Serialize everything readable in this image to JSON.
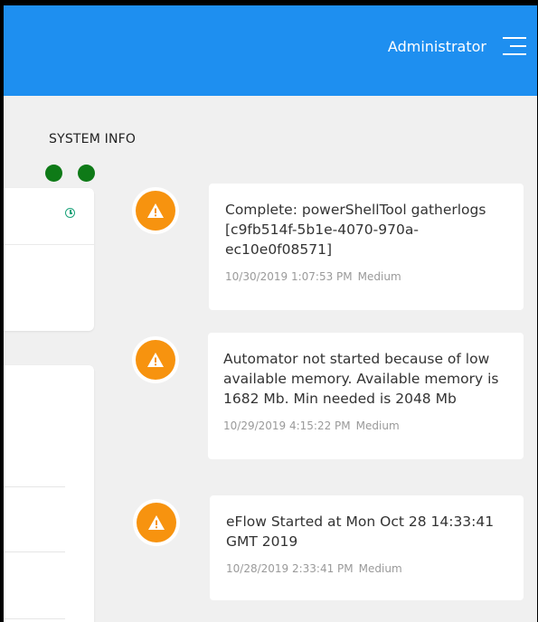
{
  "header": {
    "user": "Administrator",
    "menu_icon": "hamburger-menu-icon",
    "background_color": "#1e8ff0"
  },
  "section": {
    "title": "SYSTEM INFO",
    "indicator_color": "#0e7a17"
  },
  "icons": {
    "panel_clock": "clock-icon",
    "notification": "warning-icon",
    "notification_color": "#f7930f"
  },
  "notifications": [
    {
      "message": "Complete: powerShellTool gatherlogs [c9fb514f-5b1e-4070-970a-ec10e0f08571]",
      "timestamp": "10/30/2019 1:07:53 PM",
      "severity": "Medium"
    },
    {
      "message": "Automator not started because of low available memory. Available memory is 1682 Mb. Min needed is 2048 Mb",
      "timestamp": "10/29/2019 4:15:22 PM",
      "severity": "Medium"
    },
    {
      "message": "eFlow Started at Mon Oct 28 14:33:41 GMT 2019",
      "timestamp": "10/28/2019 2:33:41 PM",
      "severity": "Medium"
    }
  ]
}
